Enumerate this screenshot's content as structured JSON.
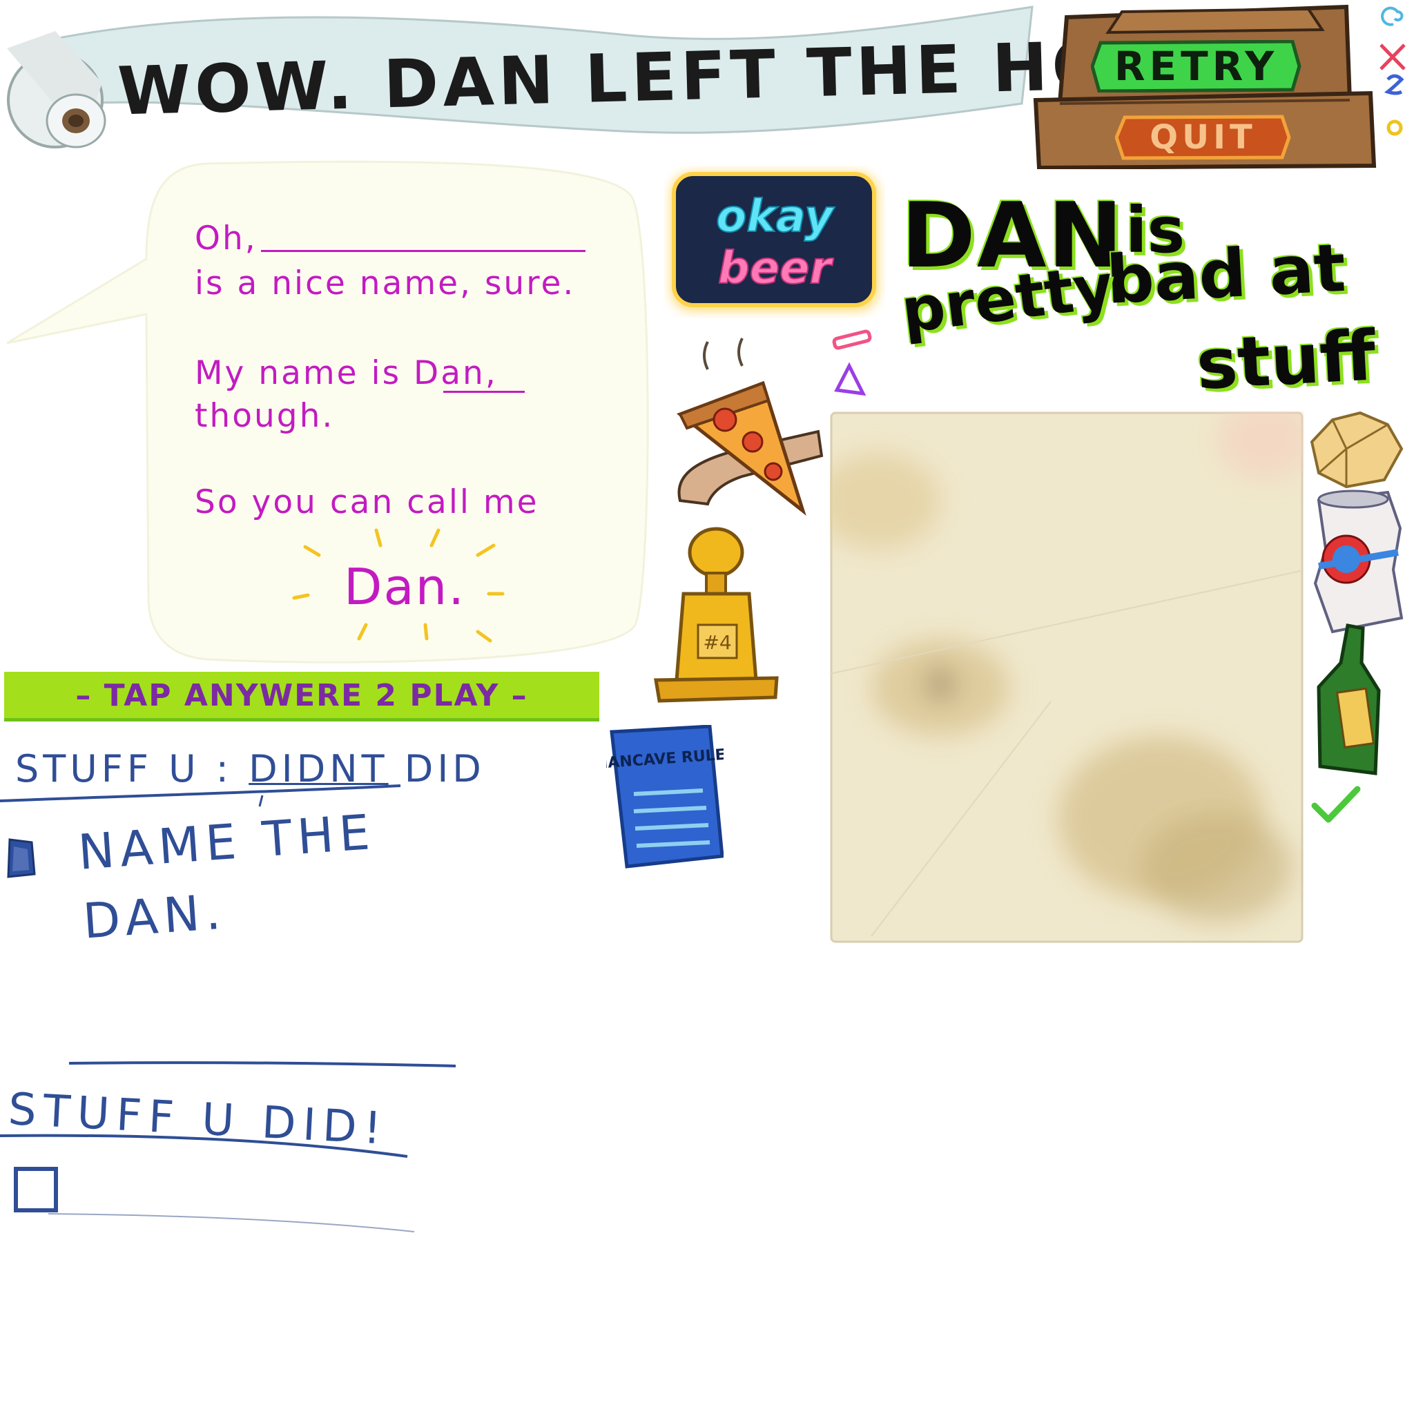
{
  "header": {
    "title": "WOW. DAN LEFT THE HOUSE!"
  },
  "menu": {
    "retry_label": "RETRY",
    "quit_label": "QUIT"
  },
  "dialog": {
    "line_oh": "Oh,",
    "line_nice": "is a nice name, sure.",
    "line_myname": "My name is",
    "line_myname_dan": "Dan,",
    "line_though": "though.",
    "line_callme": "So you can call me",
    "line_dan_big": "Dan."
  },
  "play": {
    "tap_label": "– TAP ANYWERE 2 PLAY –"
  },
  "checklist": {
    "didnt_heading_prefix": "STUFF U",
    "didnt_heading_word": "DIDNT",
    "didnt_heading_suffix": "DID",
    "didnt_tasks": [
      {
        "text": "NAME THE DAN."
      }
    ],
    "did_heading": "STUFF U DID!",
    "did_tasks": []
  },
  "neon_sign": {
    "line1": "okay",
    "line2": "beer"
  },
  "rating": {
    "word_dan": "DAN",
    "word_is": "is",
    "word_pretty": "pretty",
    "word_badat": "bad at",
    "word_stuff": "stuff"
  },
  "trophy": {
    "plaque": "#4"
  },
  "rulebook": {
    "title": "MANCAVE RULES"
  },
  "colors": {
    "dialog_text": "#c21bc2",
    "handwriting": "#2f4e96",
    "tap_bar": "#a4df1c",
    "tap_text": "#7b2aa3",
    "retry_green": "#3fd34a",
    "quit_orange": "#c9521d",
    "highlight_green": "#8de01e"
  }
}
